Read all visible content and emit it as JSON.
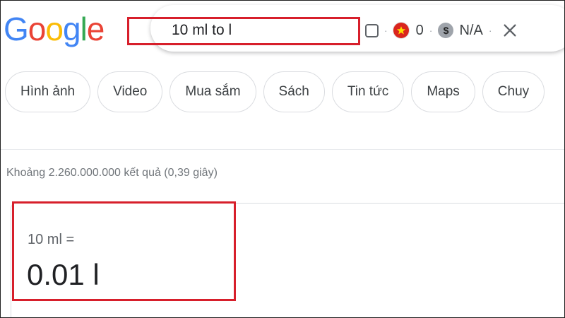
{
  "logo": {
    "letters": [
      {
        "char": "G",
        "color": "#4285F4"
      },
      {
        "char": "o",
        "color": "#EA4335"
      },
      {
        "char": "o",
        "color": "#FBBC05"
      },
      {
        "char": "g",
        "color": "#4285F4"
      },
      {
        "char": "l",
        "color": "#34A853"
      },
      {
        "char": "e",
        "color": "#EA4335"
      }
    ]
  },
  "search": {
    "query": "10 ml to l"
  },
  "toolbar": {
    "flag_count": "0",
    "price_value": "N/A",
    "icons": {
      "checkbox": "checkbox-icon",
      "flag": "vietnam-flag-icon",
      "dollar": "dollar-icon",
      "close": "close-icon"
    }
  },
  "chips": [
    {
      "label": "Hình ảnh"
    },
    {
      "label": "Video"
    },
    {
      "label": "Mua sắm"
    },
    {
      "label": "Sách"
    },
    {
      "label": "Tin tức"
    },
    {
      "label": "Maps"
    },
    {
      "label": "Chuy"
    }
  ],
  "results": {
    "stats": "Khoảng 2.260.000.000 kết quả (0,39 giây)"
  },
  "converter": {
    "query": "10 ml =",
    "value": "0.01 l"
  },
  "colors": {
    "highlight": "#d71f2b",
    "flag_red": "#da251d",
    "flag_star": "#ffdd00"
  }
}
